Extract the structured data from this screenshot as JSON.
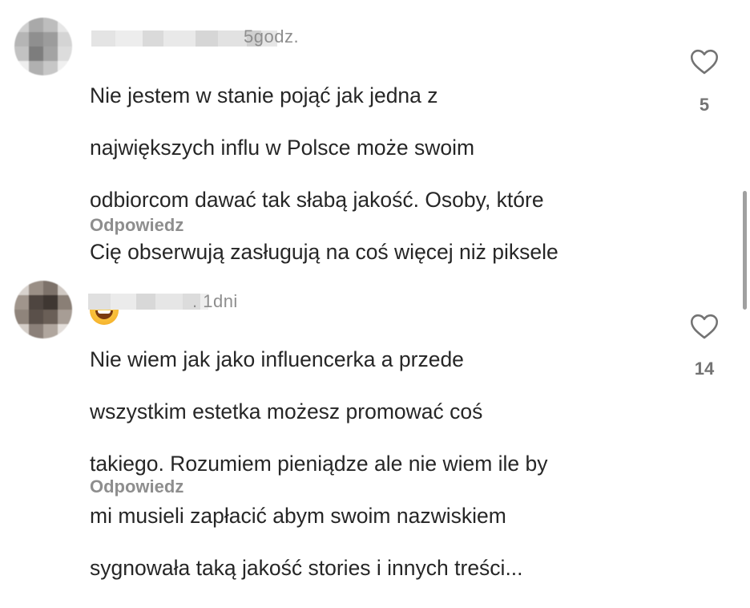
{
  "comments": [
    {
      "time": "5godz.",
      "lines": [
        "Nie jestem w stanie pojąć jak jedna z",
        "największych influ w Polsce może swoim",
        "odbiorcom dawać tak słabą jakość. Osoby, które",
        "Cię obserwują zasługują na coś więcej niż piksele"
      ],
      "emoji": "grinning-face-with-sweat",
      "reply_label": "Odpowiedz",
      "like_count": "5"
    },
    {
      "time": ". 1dni",
      "lines": [
        "Nie wiem jak jako influencerka a przede",
        "wszystkim estetka możesz promować coś",
        "takiego. Rozumiem pieniądze ale nie wiem ile by",
        "mi musieli zapłacić abym swoim nazwiskiem",
        "sygnowała taką jakość stories i innych treści..."
      ],
      "reply_label": "Odpowiedz",
      "like_count": "14"
    }
  ],
  "icons": {
    "like": "heart-outline-icon"
  },
  "colors": {
    "text": "#262626",
    "muted": "#8e8e8e",
    "count": "#737373"
  }
}
